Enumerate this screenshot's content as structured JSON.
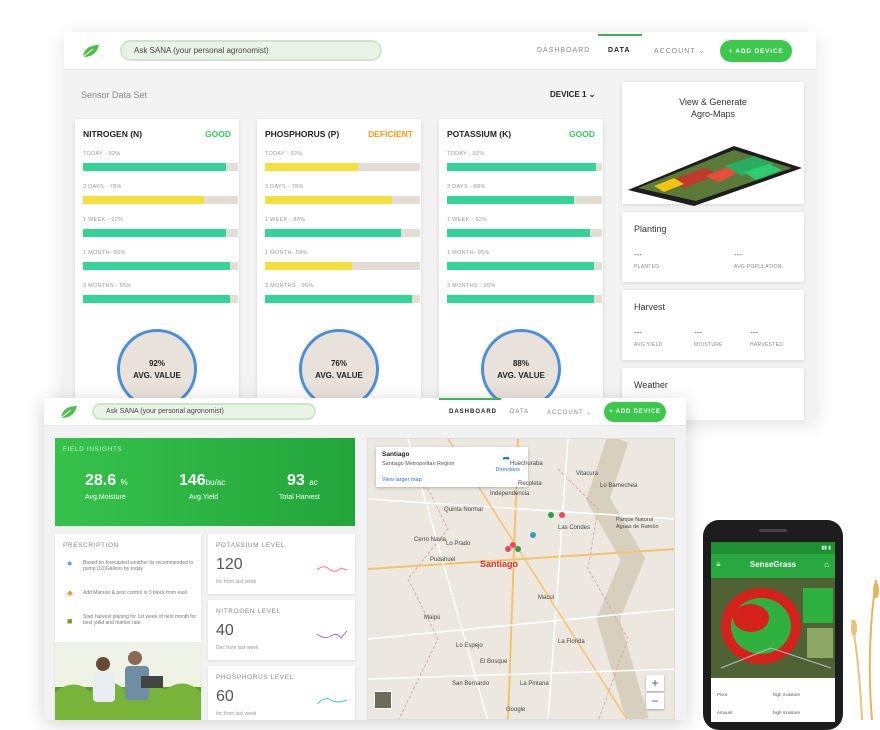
{
  "back": {
    "search_placeholder": "Ask SANA (your personal agronomist)",
    "nav": [
      "DASHBOARD",
      "DATA",
      "ACCOUNT"
    ],
    "add_device": "+ ADD DEVICE",
    "section_title": "Sensor Data Set",
    "device_select": "DEVICE 1",
    "nutrient_cards": [
      {
        "title": "NITROGEN (N)",
        "status": "GOOD",
        "status_color": "#3ec45a",
        "rows": [
          {
            "label": "TODAY - 92%",
            "value": 92,
            "color": "#34d399"
          },
          {
            "label": "3 DAYS - 78%",
            "value": 78,
            "color": "#f5e03b"
          },
          {
            "label": "1 WEEK - 92%",
            "value": 92,
            "color": "#34d399"
          },
          {
            "label": "1 MONTH- 95%",
            "value": 95,
            "color": "#34d399"
          },
          {
            "label": "3 MONTHS - 95%",
            "value": 95,
            "color": "#34d399"
          }
        ],
        "gauge_value": "92%",
        "gauge_label": "AVG. VALUE"
      },
      {
        "title": "PHOSPHORUS (P)",
        "status": "DEFICIENT",
        "status_color": "#f39c12",
        "rows": [
          {
            "label": "TODAY - 92%",
            "value": 60,
            "color": "#f5e03b"
          },
          {
            "label": "3 DAYS - 78%",
            "value": 82,
            "color": "#f5e03b"
          },
          {
            "label": "1 WEEK - 88%",
            "value": 88,
            "color": "#34d399"
          },
          {
            "label": "1 MONTH- 58%",
            "value": 56,
            "color": "#f5e03b"
          },
          {
            "label": "3 MONTHS - 95%",
            "value": 95,
            "color": "#34d399"
          }
        ],
        "gauge_value": "76%",
        "gauge_label": "AVG. VALUE"
      },
      {
        "title": "POTASSIUM (K)",
        "status": "GOOD",
        "status_color": "#3ec45a",
        "rows": [
          {
            "label": "TODAY - 92%",
            "value": 96,
            "color": "#34d399"
          },
          {
            "label": "3 DAYS - 88%",
            "value": 82,
            "color": "#34d399"
          },
          {
            "label": "1 WEEK - 92%",
            "value": 92,
            "color": "#34d399"
          },
          {
            "label": "1 MONTH- 95%",
            "value": 95,
            "color": "#34d399"
          },
          {
            "label": "3 MONTHS - 95%",
            "value": 95,
            "color": "#34d399"
          }
        ],
        "gauge_value": "88%",
        "gauge_label": "AVG. VALUE"
      }
    ],
    "agromaps_title": "View & Generate\nAgro-Maps",
    "planting": {
      "title": "Planting",
      "stats": [
        {
          "value": "---",
          "label": "PLANTED"
        },
        {
          "value": "---",
          "label": "AVG POPULATION"
        }
      ]
    },
    "harvest": {
      "title": "Harvest",
      "stats": [
        {
          "value": "---",
          "label": "AVG YIELD"
        },
        {
          "value": "---",
          "label": "MOISTURE"
        },
        {
          "value": "---",
          "label": "HARVESTED"
        }
      ]
    },
    "weather": {
      "title": "Weather"
    }
  },
  "front": {
    "search_placeholder": "Ask SANA (your personal agronomist)",
    "nav": [
      "DASHBOARD",
      "DATA",
      "ACCOUNT"
    ],
    "add_device": "+ ADD DEVICE",
    "insights": {
      "title": "FIELD INSIGHTS",
      "items": [
        {
          "value": "28.6",
          "unit": "%",
          "label": "Avg.Moisture"
        },
        {
          "value": "146",
          "unit": "bu/ac",
          "label": "Avg.Yield"
        },
        {
          "value": "93",
          "unit": "ac",
          "label": "Total Harvest"
        }
      ]
    },
    "prescription": {
      "title": "PRESCRIPTION",
      "items": [
        {
          "icon": "water-drop-icon",
          "glyph": "💧",
          "text": "Based on forecasted weather its recommended to pump (10)Gallons by today"
        },
        {
          "icon": "fertilizer-icon",
          "glyph": "🌽",
          "text": "Add Manure & pest control in 3 block from east"
        },
        {
          "icon": "tractor-icon",
          "glyph": "🚜",
          "text": "Start harvest planing for 1st week of next month for best yield and market rate"
        }
      ]
    },
    "levels": [
      {
        "title": "POTASSIUM LEVEL",
        "value": "120",
        "sub": "Inc from last week",
        "color": "#ff7a8a"
      },
      {
        "title": "NITROGEN LEVEL",
        "value": "40",
        "sub": "Dec from last week",
        "color": "#a46ee8"
      },
      {
        "title": "PHOSPHORUS LEVEL",
        "value": "60",
        "sub": "Inc from last week",
        "color": "#3cc8c0"
      }
    ],
    "map": {
      "info_title": "Santiago",
      "info_sub": "Santiago Metropolitan Region",
      "directions": "Directions",
      "larger": "View larger map",
      "labels": [
        {
          "text": "Santiago",
          "cls": "city"
        },
        {
          "text": "Las Condes"
        },
        {
          "text": "Pudahuel"
        },
        {
          "text": "Cerro Navia"
        },
        {
          "text": "Lo Prado"
        },
        {
          "text": "Quinta Normal"
        },
        {
          "text": "Independencia"
        },
        {
          "text": "Recoleta"
        },
        {
          "text": "Huechuraba"
        },
        {
          "text": "Vitacura"
        },
        {
          "text": "Lo Barnechea"
        },
        {
          "text": "Macul"
        },
        {
          "text": "Maipú"
        },
        {
          "text": "Lo Espejo"
        },
        {
          "text": "La Florida"
        },
        {
          "text": "El Bosque"
        },
        {
          "text": "San Bernardo"
        },
        {
          "text": "La Pintana"
        },
        {
          "text": "Parque Natural Aguas de Ramón"
        },
        {
          "text": "Google"
        }
      ]
    }
  },
  "phone": {
    "app_title": "SenseGrass",
    "rows": [
      {
        "left": "Pivot",
        "right": "high moisture"
      },
      {
        "left": "Amount",
        "right": "high moisture"
      }
    ]
  }
}
